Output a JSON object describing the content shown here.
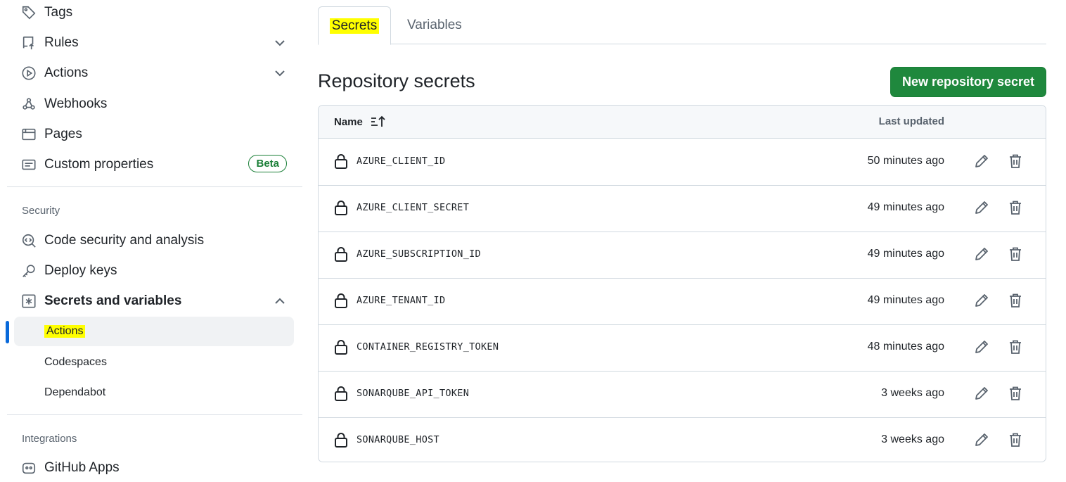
{
  "sidebar": {
    "items_top": [
      {
        "label": "Tags",
        "icon": "tag-icon"
      },
      {
        "label": "Rules",
        "icon": "repo-push-icon"
      },
      {
        "label": "Actions",
        "icon": "play-icon"
      },
      {
        "label": "Webhooks",
        "icon": "webhook-icon"
      },
      {
        "label": "Pages",
        "icon": "browser-icon"
      },
      {
        "label": "Custom properties",
        "icon": "note-icon",
        "badge": "Beta"
      }
    ],
    "security_heading": "Security",
    "security_items": [
      {
        "label": "Code security and analysis",
        "icon": "codescan-icon"
      },
      {
        "label": "Deploy keys",
        "icon": "key-icon"
      },
      {
        "label": "Secrets and variables",
        "icon": "asterisk-icon"
      }
    ],
    "secrets_sub": [
      {
        "label": "Actions"
      },
      {
        "label": "Codespaces"
      },
      {
        "label": "Dependabot"
      }
    ],
    "integrations_heading": "Integrations",
    "integrations_first": "GitHub Apps"
  },
  "tabs": {
    "secrets": "Secrets",
    "variables": "Variables"
  },
  "main": {
    "title": "Repository secrets",
    "new_button": "New repository secret",
    "col_name": "Name",
    "col_updated": "Last updated"
  },
  "secrets": [
    {
      "name": "AZURE_CLIENT_ID",
      "updated": "50 minutes ago"
    },
    {
      "name": "AZURE_CLIENT_SECRET",
      "updated": "49 minutes ago"
    },
    {
      "name": "AZURE_SUBSCRIPTION_ID",
      "updated": "49 minutes ago"
    },
    {
      "name": "AZURE_TENANT_ID",
      "updated": "49 minutes ago"
    },
    {
      "name": "CONTAINER_REGISTRY_TOKEN",
      "updated": "48 minutes ago"
    },
    {
      "name": "SONARQUBE_API_TOKEN",
      "updated": "3 weeks ago"
    },
    {
      "name": "SONARQUBE_HOST",
      "updated": "3 weeks ago"
    }
  ],
  "colors": {
    "primary_button": "#1f883d",
    "highlight": "#ffff00",
    "active_indicator": "#0969da",
    "beta_badge": "#1a7f37"
  }
}
